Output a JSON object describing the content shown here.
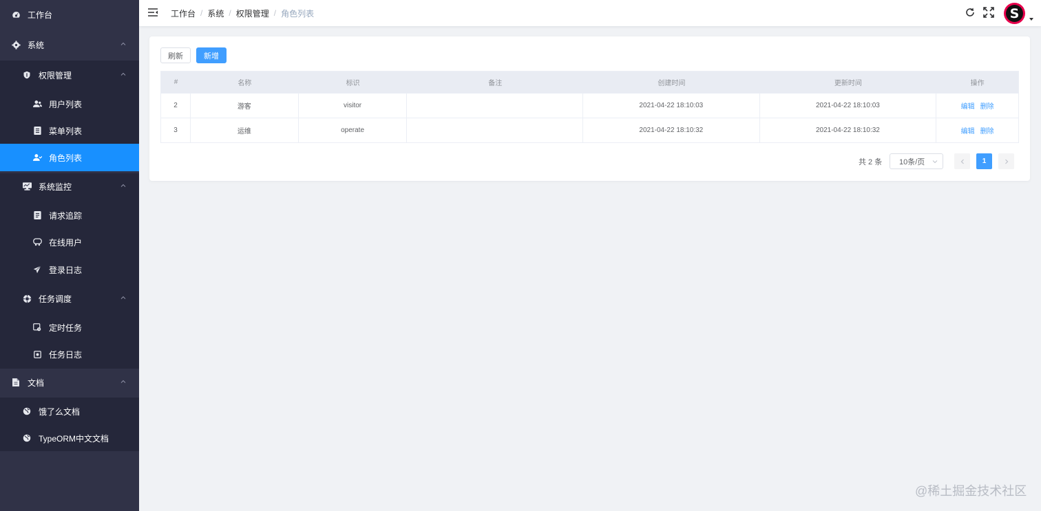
{
  "sidebar": {
    "items": [
      {
        "label": "工作台",
        "icon": "dashboard-icon"
      },
      {
        "label": "系统",
        "icon": "gear-icon"
      },
      {
        "label": "权限管理",
        "icon": "shield-icon"
      },
      {
        "label": "用户列表",
        "icon": "users-icon"
      },
      {
        "label": "菜单列表",
        "icon": "menu-list-icon"
      },
      {
        "label": "角色列表",
        "icon": "role-icon"
      },
      {
        "label": "系统监控",
        "icon": "monitor-icon"
      },
      {
        "label": "请求追踪",
        "icon": "request-trace-icon"
      },
      {
        "label": "在线用户",
        "icon": "online-users-icon"
      },
      {
        "label": "登录日志",
        "icon": "paper-plane-icon"
      },
      {
        "label": "任务调度",
        "icon": "schedule-icon"
      },
      {
        "label": "定时任务",
        "icon": "timer-task-icon"
      },
      {
        "label": "任务日志",
        "icon": "task-log-icon"
      },
      {
        "label": "文档",
        "icon": "document-icon"
      },
      {
        "label": "饿了么文档",
        "icon": "globe-icon"
      },
      {
        "label": "TypeORM中文文档",
        "icon": "globe-icon"
      }
    ]
  },
  "header": {
    "breadcrumb": [
      "工作台",
      "系统",
      "权限管理",
      "角色列表"
    ],
    "separator": "/",
    "avatar_letter": "S"
  },
  "toolbar": {
    "refresh_label": "刷新",
    "add_label": "新增"
  },
  "table": {
    "columns": [
      "#",
      "名称",
      "标识",
      "备注",
      "创建时间",
      "更新时间",
      "操作"
    ],
    "rows": [
      {
        "id": "2",
        "name": "游客",
        "key": "visitor",
        "remark": "",
        "created": "2021-04-22 18:10:03",
        "updated": "2021-04-22 18:10:03"
      },
      {
        "id": "3",
        "name": "运维",
        "key": "operate",
        "remark": "",
        "created": "2021-04-22 18:10:32",
        "updated": "2021-04-22 18:10:32"
      }
    ],
    "edit_label": "编辑",
    "delete_label": "删除"
  },
  "pagination": {
    "total_text": "共 2 条",
    "page_size": "10条/页",
    "current_page": "1"
  },
  "watermark": "@稀土掘金技术社区",
  "colors": {
    "sidebar_bg": "#303247",
    "active": "#1890ff",
    "primary": "#409eff"
  }
}
